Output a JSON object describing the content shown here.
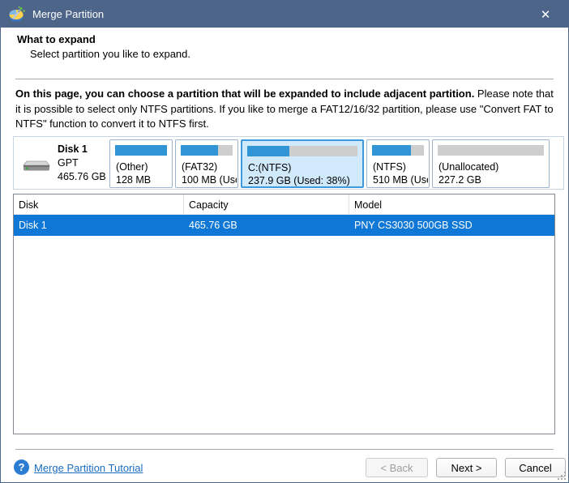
{
  "window": {
    "title": "Merge Partition",
    "close_icon": "✕"
  },
  "header": {
    "title": "What to expand",
    "subtitle": "Select partition you like to expand."
  },
  "instruction": {
    "bold": "On this page, you can choose a partition that will be expanded to include adjacent partition.",
    "normal": " Please note that it is possible to select only NTFS partitions. If you like to merge a FAT12/16/32 partition, please use \"Convert FAT to NTFS\" function to convert it to NTFS first."
  },
  "disk_strip": {
    "disk": {
      "name": "Disk 1",
      "scheme": "GPT",
      "size": "465.76 GB"
    },
    "partitions": [
      {
        "name": "(Other)",
        "size": "128 MB",
        "used_pct": 100,
        "selected": false
      },
      {
        "name": "(FAT32)",
        "size": "100 MB (Usec",
        "used_pct": 72,
        "selected": false
      },
      {
        "name": "C:(NTFS)",
        "size": "237.9 GB (Used: 38%)",
        "used_pct": 38,
        "selected": true
      },
      {
        "name": "(NTFS)",
        "size": "510 MB (Usec",
        "used_pct": 75,
        "selected": false
      },
      {
        "name": "(Unallocated)",
        "size": "227.2 GB",
        "used_pct": 0,
        "selected": false
      }
    ]
  },
  "table": {
    "columns": {
      "disk": "Disk",
      "capacity": "Capacity",
      "model": "Model"
    },
    "rows": [
      {
        "disk": "Disk 1",
        "capacity": "465.76 GB",
        "model": "PNY CS3030 500GB SSD",
        "selected": true
      }
    ]
  },
  "footer": {
    "help_icon": "?",
    "help_link": "Merge Partition Tutorial",
    "buttons": {
      "back": {
        "label": "< Back",
        "enabled": false
      },
      "next": {
        "label": "Next >",
        "enabled": true
      },
      "cancel": {
        "label": "Cancel",
        "enabled": true
      }
    }
  },
  "colors": {
    "titlebar": "#4d6588",
    "selection_blue": "#0f78d7",
    "usage_bar_blue": "#3095d5",
    "selected_partition_bg": "#d0e9fb",
    "link": "#1a6dc0"
  }
}
